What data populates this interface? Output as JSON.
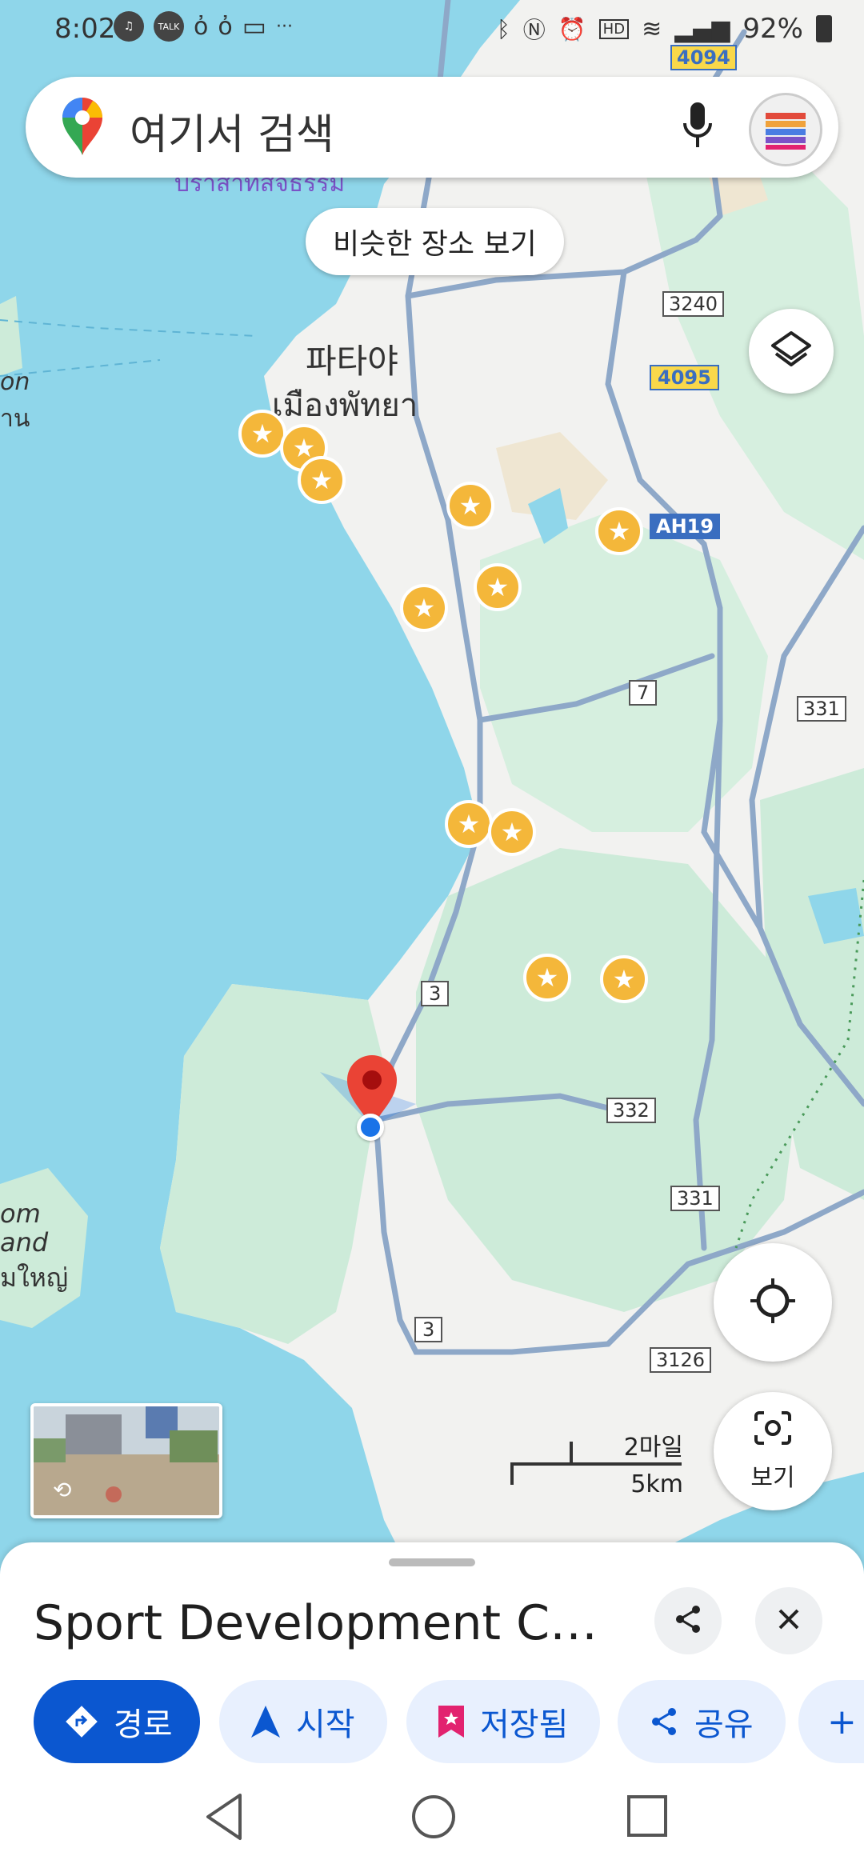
{
  "status_bar": {
    "time": "8:02",
    "left_icons": [
      "music-icon",
      "talk-icon",
      "notification-icon",
      "notification-icon",
      "message-icon"
    ],
    "more": "···",
    "battery_percent": "92%",
    "colors": {
      "text": "#333333"
    }
  },
  "search": {
    "placeholder": "여기서 검색",
    "icons": [
      "maps-pin-icon",
      "mic-icon",
      "avatar"
    ]
  },
  "map": {
    "similar_places_chip": "비슷한 장소 보기",
    "city_label_ko": "파타야",
    "city_label_th": "เมืองพัทยา",
    "top_label": "บราสาทสจธรรม",
    "left_labels": [
      "on",
      "าน",
      "om",
      "and",
      "มใหญ่"
    ],
    "road_shields": [
      "4094",
      "3240",
      "4095",
      "AH19",
      "7",
      "331",
      "3",
      "332",
      "331",
      "3",
      "3126"
    ],
    "scale": {
      "miles": "2마일",
      "km": "5km"
    },
    "colors": {
      "water": "#8fd6ea",
      "land": "#f2f2f0",
      "green": "#cdebd9",
      "road": "#8ea8c8",
      "star": "#f4b73a",
      "pin": "#ea4335",
      "blue_dot": "#1a73e8"
    }
  },
  "controls": {
    "layers_icon": "layers-icon",
    "locate_icon": "my-location-icon",
    "lens_label": "보기"
  },
  "place_sheet": {
    "title": "Sport Development Ce...",
    "share_icon": "share-icon",
    "close_icon": "close-icon",
    "actions": [
      {
        "label": "경로",
        "icon": "directions-icon"
      },
      {
        "label": "시작",
        "icon": "navigation-arrow-icon"
      },
      {
        "label": "저장됨",
        "icon": "bookmark-icon"
      },
      {
        "label": "공유",
        "icon": "share-icon"
      },
      {
        "label": "+",
        "icon": ""
      }
    ],
    "colors": {
      "primary": "#0b57d0",
      "chip_bg": "#e8f0fe",
      "saved_icon": "#e2226f"
    }
  },
  "nav_bar": {
    "items": [
      "back-icon",
      "home-icon",
      "recents-icon"
    ]
  }
}
